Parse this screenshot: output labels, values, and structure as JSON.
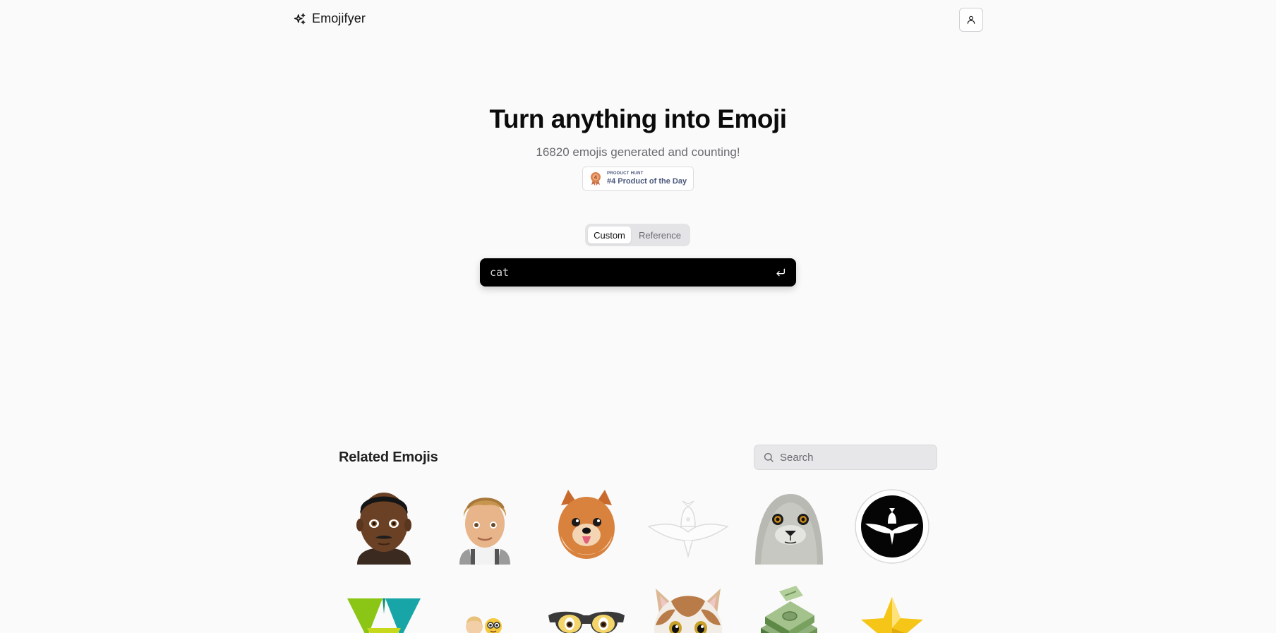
{
  "header": {
    "app_name": "Emojifyer",
    "logo_icon": "sparkles-icon",
    "account_icon": "user-icon"
  },
  "hero": {
    "title": "Turn anything into Emoji",
    "subtitle": "16820 emojis generated and counting!"
  },
  "product_hunt_badge": {
    "kicker": "PRODUCT HUNT",
    "label": "#4 Product of the Day",
    "icon": "medal-icon"
  },
  "mode_toggle": {
    "options": [
      "Custom",
      "Reference"
    ],
    "selected": "Custom"
  },
  "prompt": {
    "value": "cat",
    "submit_icon": "enter-icon"
  },
  "related": {
    "title": "Related Emojis",
    "search_placeholder": "Search",
    "search_icon": "search-icon",
    "emojis": [
      "man-dark-skin-mustache-emoji",
      "man-blond-suspenders-emoji",
      "pomeranian-dog-emoji",
      "white-bird-emoji",
      "seal-emoji",
      "black-bird-circle-emoji",
      "green-teal-triangle-logo-emoji",
      "small-faces-emoji",
      "glasses-with-eyes-emoji",
      "cat-face-emoji",
      "money-stack-emoji",
      "gold-star-emoji"
    ]
  },
  "colors": {
    "background": "#fafafa",
    "prompt_bg": "#000000",
    "badge_text": "#4b587c",
    "muted_text": "#6b6b72"
  }
}
